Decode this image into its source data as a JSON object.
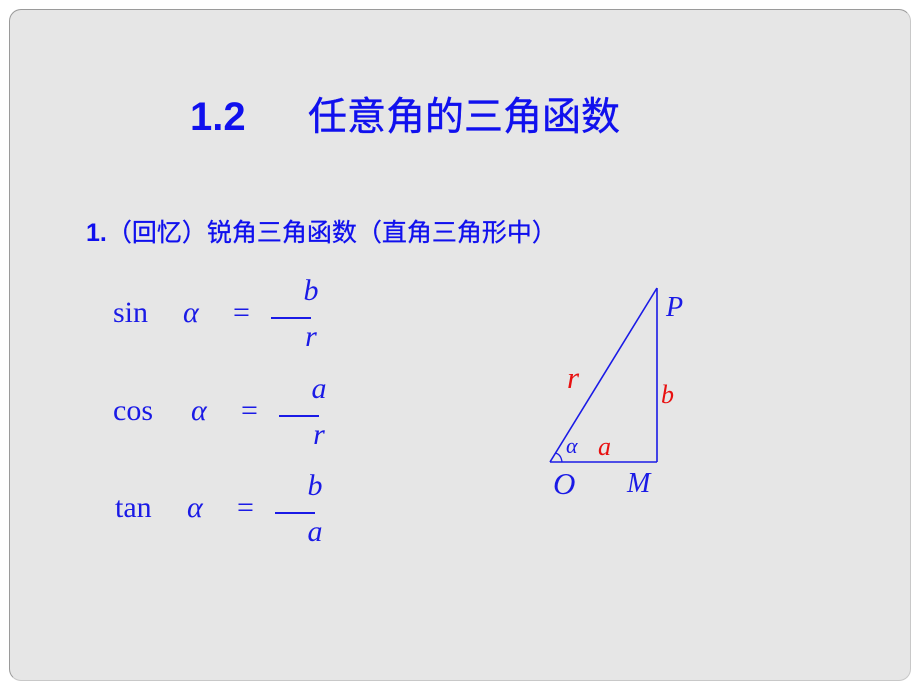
{
  "slide": {
    "title_number": "1.2",
    "title_text": "任意角的三角函数",
    "subtitle_number": "1.",
    "subtitle_text": "（回忆）锐角三角函数（直角三角形中）"
  },
  "formulas": [
    {
      "fn": "sin",
      "angle": "α",
      "eq": "=",
      "numerator": "b",
      "denominator": "r"
    },
    {
      "fn": "cos",
      "angle": "α",
      "eq": "=",
      "numerator": "a",
      "denominator": "r"
    },
    {
      "fn": "tan",
      "angle": "α",
      "eq": "=",
      "numerator": "b",
      "denominator": "a"
    }
  ],
  "diagram": {
    "vertex_labels": {
      "origin": "O",
      "foot": "M",
      "top": "P"
    },
    "side_labels": {
      "hypotenuse": "r",
      "adjacent": "a",
      "opposite": "b"
    },
    "angle_label": "α",
    "colors": {
      "lines": "#1a1ae6",
      "vertex_labels": "#1a1ae6",
      "side_labels": "#e81010"
    }
  }
}
